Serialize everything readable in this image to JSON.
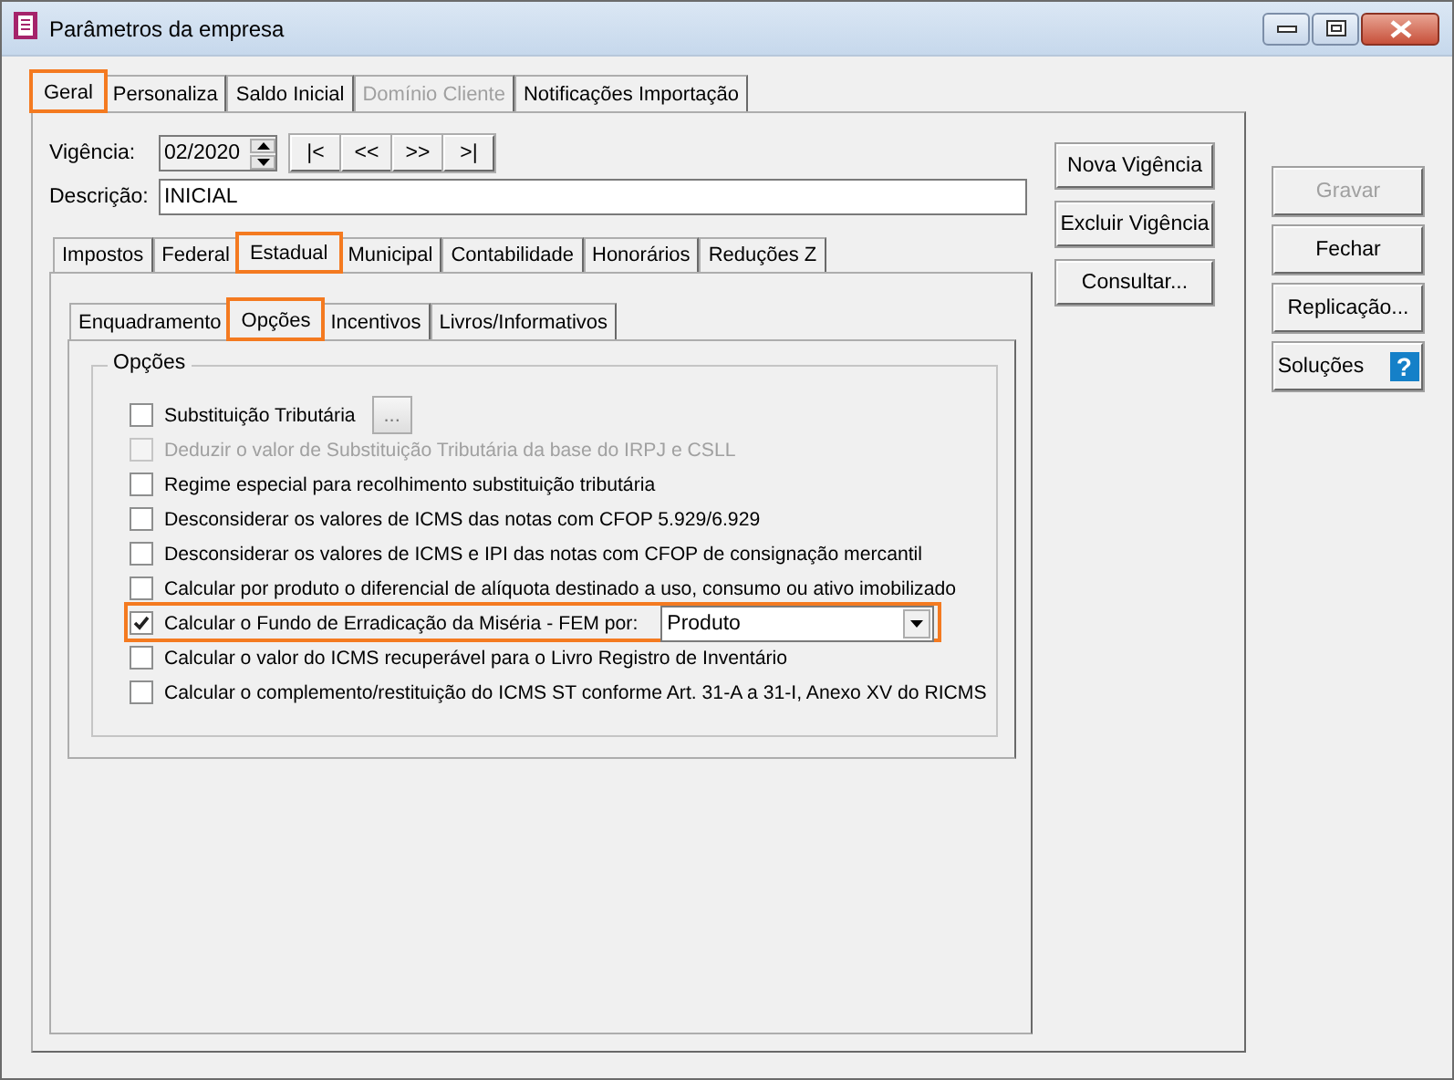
{
  "window": {
    "title": "Parâmetros da empresa"
  },
  "tabs": [
    {
      "label": "Geral",
      "selected": true,
      "highlighted": true,
      "disabled": false
    },
    {
      "label": "Personaliza",
      "selected": false,
      "highlighted": false,
      "disabled": false
    },
    {
      "label": "Saldo Inicial",
      "selected": false,
      "highlighted": false,
      "disabled": false
    },
    {
      "label": "Domínio Cliente",
      "selected": false,
      "highlighted": false,
      "disabled": true
    },
    {
      "label": "Notificações Importação",
      "selected": false,
      "highlighted": false,
      "disabled": false
    }
  ],
  "vigencia": {
    "label": "Vigência:",
    "value": "02/2020",
    "nav_buttons": [
      "|<",
      "<<",
      ">>",
      ">|"
    ]
  },
  "descricao": {
    "label": "Descrição:",
    "value": "INICIAL"
  },
  "vigencia_buttons": [
    "Nova Vigência",
    "Excluir Vigência",
    "Consultar..."
  ],
  "tax_tabs": [
    {
      "label": "Impostos",
      "selected": false,
      "highlighted": false
    },
    {
      "label": "Federal",
      "selected": false,
      "highlighted": false
    },
    {
      "label": "Estadual",
      "selected": true,
      "highlighted": true
    },
    {
      "label": "Municipal",
      "selected": false,
      "highlighted": false
    },
    {
      "label": "Contabilidade",
      "selected": false,
      "highlighted": false
    },
    {
      "label": "Honorários",
      "selected": false,
      "highlighted": false
    },
    {
      "label": "Reduções Z",
      "selected": false,
      "highlighted": false
    }
  ],
  "state_tabs": [
    {
      "label": "Enquadramento",
      "selected": false,
      "highlighted": false
    },
    {
      "label": "Opções",
      "selected": true,
      "highlighted": true
    },
    {
      "label": "Incentivos",
      "selected": false,
      "highlighted": false
    },
    {
      "label": "Livros/Informativos",
      "selected": false,
      "highlighted": false
    }
  ],
  "options_group": {
    "title": "Opções",
    "options": [
      {
        "kind": "button",
        "label": "Substituição Tributária",
        "checked": false,
        "disabled": false,
        "highlighted": false,
        "button": "..."
      },
      {
        "kind": "plain",
        "label": "Deduzir o valor de Substituição Tributária da base do IRPJ e CSLL",
        "checked": false,
        "disabled": true,
        "highlighted": false
      },
      {
        "kind": "plain",
        "label": "Regime especial para recolhimento substituição tributária",
        "checked": false,
        "disabled": false,
        "highlighted": false
      },
      {
        "kind": "plain",
        "label": "Desconsiderar os valores de ICMS das notas com CFOP 5.929/6.929",
        "checked": false,
        "disabled": false,
        "highlighted": false
      },
      {
        "kind": "plain",
        "label": "Desconsiderar os valores de ICMS e IPI das notas com CFOP de consignação mercantil",
        "checked": false,
        "disabled": false,
        "highlighted": false
      },
      {
        "kind": "plain",
        "label": "Calcular por produto o diferencial de alíquota destinado a uso, consumo ou ativo imobilizado",
        "checked": false,
        "disabled": false,
        "highlighted": false
      },
      {
        "kind": "select",
        "label": "Calcular o Fundo de Erradicação da Miséria - FEM por:",
        "checked": true,
        "disabled": false,
        "highlighted": true,
        "value": "Produto"
      },
      {
        "kind": "plain",
        "label": "Calcular o valor do ICMS recuperável para o Livro Registro de Inventário",
        "checked": false,
        "disabled": false,
        "highlighted": false
      },
      {
        "kind": "plain",
        "label": "Calcular o complemento/restituição do ICMS ST conforme Art. 31-A a 31-I, Anexo XV do RICMS",
        "checked": false,
        "disabled": false,
        "highlighted": false
      }
    ]
  },
  "side_buttons": [
    {
      "kind": "plain",
      "label": "Gravar",
      "disabled": true
    },
    {
      "kind": "plain",
      "label": "Fechar",
      "disabled": false
    },
    {
      "kind": "plain",
      "label": "Replicação...",
      "disabled": false
    },
    {
      "kind": "help",
      "label": "Soluções",
      "disabled": false,
      "icon": "?"
    }
  ]
}
